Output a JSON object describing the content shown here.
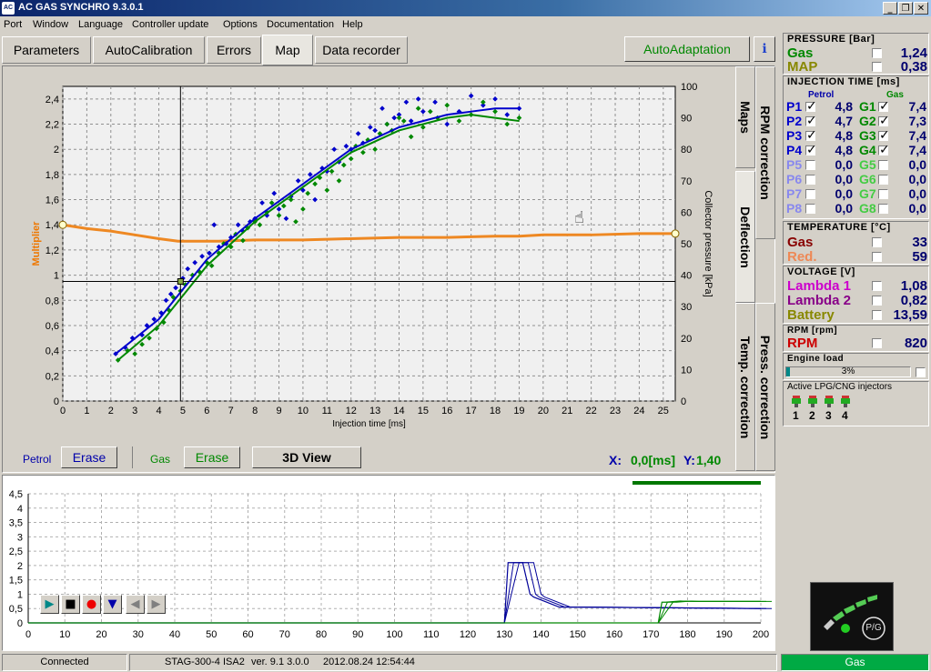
{
  "window": {
    "title": "AC GAS SYNCHRO  9.3.0.1",
    "logo": "AC"
  },
  "menu": [
    "Port",
    "Window",
    "Language",
    "Controller update",
    "Options",
    "Documentation",
    "Help"
  ],
  "tabs": {
    "parameters": "Parameters",
    "autocalibration": "AutoCalibration",
    "errors": "Errors",
    "map": "Map",
    "data_recorder": "Data recorder"
  },
  "toolbar": {
    "autoadaptation": "AutoAdaptation"
  },
  "side_tabs": {
    "maps": "Maps",
    "rpm_correction": "RPM correction",
    "deflection": "Deflection",
    "press_correction": "Press. correction",
    "temp_correction": "Temp. correction"
  },
  "controls": {
    "petrol_label": "Petrol",
    "petrol_erase": "Erase",
    "gas_label": "Gas",
    "gas_erase": "Erase",
    "view3d": "3D View",
    "cursor_x_label": "X:",
    "cursor_x": "0,0[ms]",
    "cursor_y_label": "Y:",
    "cursor_y": "1,40"
  },
  "chart_data": [
    {
      "type": "scatter",
      "xlabel": "Injection time [ms]",
      "ylabel": "Multiplier",
      "y2label": "Collector pressure [kPa]",
      "xlim": [
        0,
        25.5
      ],
      "ylim": [
        0,
        2.5
      ],
      "y2lim": [
        0,
        100
      ],
      "x_ticks": [
        0,
        1,
        2,
        3,
        4,
        5,
        6,
        7,
        8,
        9,
        10,
        11,
        12,
        13,
        14,
        15,
        16,
        17,
        18,
        19,
        20,
        21,
        22,
        23,
        24,
        25
      ],
      "y_ticks": [
        "0",
        "0,2",
        "0,4",
        "0,6",
        "0,8",
        "1",
        "1,2",
        "1,4",
        "1,6",
        "1,8",
        "2",
        "2,2",
        "2,4"
      ],
      "y2_ticks": [
        0,
        10,
        20,
        30,
        40,
        50,
        60,
        70,
        80,
        90,
        100
      ],
      "grid": true,
      "cursor": {
        "x": 4.9,
        "y2": 38
      },
      "multiplier_line": {
        "x": [
          0,
          1,
          2,
          3,
          4,
          4.8,
          5.5,
          6.5,
          8,
          10,
          12,
          14,
          16,
          18,
          19,
          20,
          22,
          24,
          25.5
        ],
        "y": [
          1.4,
          1.37,
          1.35,
          1.32,
          1.29,
          1.27,
          1.27,
          1.27,
          1.28,
          1.28,
          1.29,
          1.3,
          1.3,
          1.31,
          1.31,
          1.32,
          1.32,
          1.33,
          1.33
        ]
      },
      "series": [
        {
          "name": "Petrol",
          "color": "#0000cc",
          "x": [
            2.2,
            2.6,
            2.9,
            3.3,
            3.5,
            3.8,
            4.1,
            4.3,
            4.5,
            4.7,
            5.0,
            5.2,
            5.5,
            5.8,
            6.1,
            6.3,
            6.5,
            6.8,
            7.0,
            7.3,
            7.5,
            7.8,
            8.0,
            8.3,
            8.5,
            8.8,
            9.0,
            9.3,
            9.5,
            9.8,
            10.0,
            10.3,
            10.5,
            10.8,
            11.0,
            11.3,
            11.5,
            11.8,
            12.0,
            12.3,
            12.5,
            12.8,
            13.0,
            13.3,
            13.5,
            13.8,
            14.0,
            14.3,
            14.5,
            14.8,
            15.0,
            15.5,
            16.0,
            16.5,
            17.0,
            17.5,
            18.0,
            18.5,
            19.0
          ],
          "y2": [
            15,
            17,
            20,
            21,
            24,
            26,
            28,
            32,
            34,
            36,
            39,
            42,
            44,
            46,
            47,
            56,
            49,
            50,
            52,
            56,
            54,
            57,
            58,
            63,
            59,
            66,
            61,
            58,
            65,
            70,
            67,
            72,
            64,
            74,
            73,
            80,
            76,
            81,
            80,
            85,
            82,
            87,
            86,
            93,
            88,
            90,
            91,
            95,
            89,
            96,
            92,
            95,
            88,
            92,
            97,
            94,
            96,
            91,
            93
          ],
          "curve_x": [
            2.2,
            4,
            6,
            8,
            10,
            12,
            14,
            16,
            17,
            18,
            19
          ],
          "curve_y2": [
            15,
            26,
            45,
            58,
            69,
            80,
            87,
            91,
            92,
            93,
            93
          ]
        },
        {
          "name": "Gas",
          "color": "#008800",
          "x": [
            2.3,
            2.7,
            3.0,
            3.3,
            3.6,
            3.9,
            4.2,
            4.4,
            4.6,
            4.9,
            5.1,
            5.4,
            5.7,
            6.0,
            6.2,
            6.5,
            6.7,
            7.0,
            7.2,
            7.5,
            7.7,
            8.0,
            8.2,
            8.5,
            8.7,
            9.0,
            9.2,
            9.5,
            9.7,
            10.0,
            10.2,
            10.5,
            10.7,
            11.0,
            11.2,
            11.5,
            11.7,
            12.0,
            12.2,
            12.5,
            12.7,
            13.0,
            13.2,
            13.5,
            13.7,
            14.0,
            14.2,
            14.5,
            14.8,
            15.0,
            15.3,
            15.6,
            16.0,
            16.5,
            17.0,
            17.5,
            18.0,
            18.5,
            19.0
          ],
          "y2": [
            13,
            16,
            15,
            18,
            20,
            23,
            25,
            29,
            33,
            35,
            37,
            40,
            41,
            44,
            43,
            47,
            50,
            49,
            53,
            51,
            55,
            57,
            56,
            60,
            63,
            59,
            62,
            64,
            57,
            61,
            66,
            69,
            71,
            67,
            73,
            70,
            75,
            77,
            81,
            79,
            83,
            80,
            85,
            88,
            86,
            90,
            89,
            84,
            93,
            87,
            92,
            90,
            94,
            89,
            91,
            95,
            92,
            88,
            90
          ],
          "curve_x": [
            2.3,
            4,
            6,
            8,
            10,
            12,
            14,
            16,
            17,
            18,
            19
          ],
          "curve_y2": [
            13,
            24,
            43,
            57,
            68,
            79,
            86,
            90,
            91,
            90,
            89
          ]
        }
      ]
    },
    {
      "type": "line",
      "xlim": [
        0,
        200
      ],
      "ylim": [
        0,
        4.5
      ],
      "x_ticks": [
        0,
        10,
        20,
        30,
        40,
        50,
        60,
        70,
        80,
        90,
        100,
        110,
        120,
        130,
        140,
        150,
        160,
        170,
        180,
        190,
        200
      ],
      "y_ticks": [
        "0",
        "0,5",
        "1",
        "1,5",
        "2",
        "2,5",
        "3",
        "3,5",
        "4",
        "4,5"
      ],
      "grid": true,
      "series": [
        {
          "name": "Petrol",
          "color": "#000099",
          "x": [
            0,
            130,
            131,
            132,
            135,
            137,
            138,
            145,
            150,
            200
          ],
          "y": [
            0,
            0,
            2.1,
            2.1,
            2.1,
            1.0,
            0.9,
            0.55,
            0.55,
            0.5
          ]
        },
        {
          "name": "Gas",
          "color": "#008800",
          "x": [
            0,
            172,
            173,
            174,
            178,
            180,
            200
          ],
          "y": [
            0,
            0,
            0.72,
            0.72,
            0.76,
            0.75,
            0.75
          ]
        }
      ]
    }
  ],
  "recorder_controls": [
    "play-icon",
    "stop-icon",
    "record-icon",
    "save-icon",
    "back-icon",
    "forward-icon"
  ],
  "pressure": {
    "title": "PRESSURE [Bar]",
    "gas_label": "Gas",
    "gas_value": "1,24",
    "map_label": "MAP",
    "map_value": "0,38"
  },
  "injection": {
    "title": "INJECTION TIME [ms]",
    "petrol_header": "Petrol",
    "gas_header": "Gas",
    "rows": [
      {
        "p": "P1",
        "pv": "4,8",
        "pc": true,
        "g": "G1",
        "gv": "7,4",
        "gc": true
      },
      {
        "p": "P2",
        "pv": "4,7",
        "pc": true,
        "g": "G2",
        "gv": "7,3",
        "gc": true
      },
      {
        "p": "P3",
        "pv": "4,8",
        "pc": true,
        "g": "G3",
        "gv": "7,4",
        "gc": true
      },
      {
        "p": "P4",
        "pv": "4,8",
        "pc": true,
        "g": "G4",
        "gv": "7,4",
        "gc": true
      },
      {
        "p": "P5",
        "pv": "0,0",
        "pc": false,
        "g": "G5",
        "gv": "0,0",
        "gc": false
      },
      {
        "p": "P6",
        "pv": "0,0",
        "pc": false,
        "g": "G6",
        "gv": "0,0",
        "gc": false
      },
      {
        "p": "P7",
        "pv": "0,0",
        "pc": false,
        "g": "G7",
        "gv": "0,0",
        "gc": false
      },
      {
        "p": "P8",
        "pv": "0,0",
        "pc": false,
        "g": "G8",
        "gv": "0,0",
        "gc": false
      }
    ]
  },
  "temperature": {
    "title": "TEMPERATURE [°C]",
    "gas_label": "Gas",
    "gas_value": "33",
    "red_label": "Red.",
    "red_value": "59"
  },
  "voltage": {
    "title": "VOLTAGE [V]",
    "l1_label": "Lambda 1",
    "l1_value": "1,08",
    "l2_label": "Lambda 2",
    "l2_value": "0,82",
    "bat_label": "Battery",
    "bat_value": "13,59"
  },
  "rpm": {
    "title": "RPM [rpm]",
    "label": "RPM",
    "value": "820"
  },
  "engine_load": {
    "title": "Engine load",
    "value": "3%",
    "fraction": 0.03
  },
  "active_injectors": {
    "title": "Active LPG/CNG injectors",
    "labels": [
      "1",
      "2",
      "3",
      "4"
    ]
  },
  "fuel_switch": {
    "label": "P/G"
  },
  "status": {
    "connection": "Connected",
    "controller": "STAG-300-4 ISA2",
    "version": "ver. 9.1  3.0.0",
    "date": "2012.08.24 12:54:44",
    "fuel": "Gas"
  },
  "colors": {
    "petrol": "#0000cc",
    "gas": "#008800",
    "multiplier": "#ee8822",
    "status_gas": "#00aa44"
  }
}
